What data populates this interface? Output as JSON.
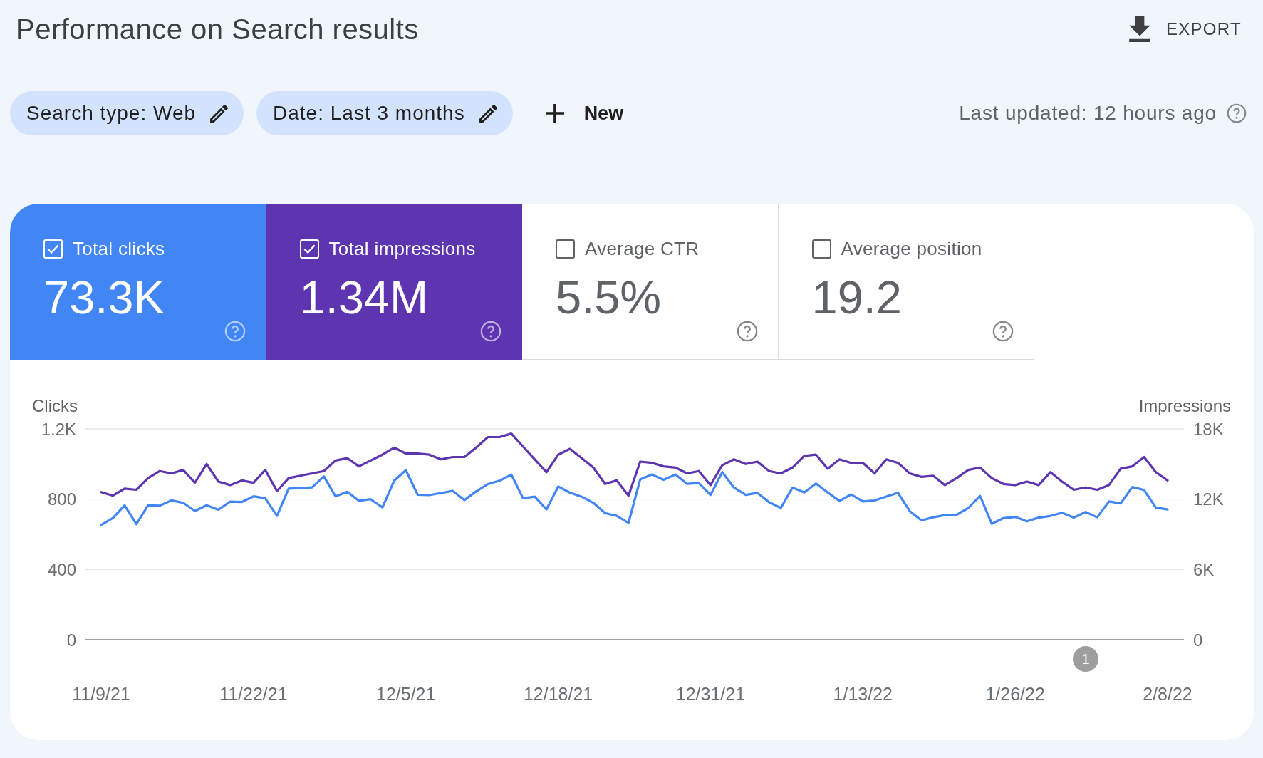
{
  "header": {
    "title": "Performance on Search results",
    "export": {
      "label": "EXPORT"
    }
  },
  "filter_bar": {
    "chips": [
      {
        "label": "Search type: Web"
      },
      {
        "label": "Date: Last 3 months"
      }
    ],
    "new_filter": {
      "label": "New"
    },
    "last_updated": "Last updated: 12 hours ago"
  },
  "metrics": [
    {
      "label": "Total clicks",
      "value": "73.3K",
      "checked": true,
      "color": "#4285f4"
    },
    {
      "label": "Total impressions",
      "value": "1.34M",
      "checked": true,
      "color": "#5e35b1"
    },
    {
      "label": "Average CTR",
      "value": "5.5%",
      "checked": false
    },
    {
      "label": "Average position",
      "value": "19.2",
      "checked": false
    }
  ],
  "chart": {
    "chart_data": {
      "type": "line",
      "ylabel": "Clicks",
      "y2label": "Impressions",
      "categories": [
        "11/9/21",
        null,
        null,
        null,
        null,
        null,
        null,
        null,
        null,
        null,
        null,
        null,
        null,
        "11/22/21",
        null,
        null,
        null,
        null,
        null,
        null,
        null,
        null,
        null,
        null,
        null,
        null,
        "12/5/21",
        null,
        null,
        null,
        null,
        null,
        null,
        null,
        null,
        null,
        null,
        null,
        null,
        "12/18/21",
        null,
        null,
        null,
        null,
        null,
        null,
        null,
        null,
        null,
        null,
        null,
        null,
        "12/31/21",
        null,
        null,
        null,
        null,
        null,
        null,
        null,
        null,
        null,
        null,
        null,
        null,
        "1/13/22",
        null,
        null,
        null,
        null,
        null,
        null,
        null,
        null,
        null,
        null,
        null,
        null,
        "1/26/22",
        null,
        null,
        null,
        null,
        null,
        null,
        null,
        null,
        null,
        null,
        null,
        null,
        "2/8/22"
      ],
      "ylim": [
        0,
        1200
      ],
      "yticks": [
        {
          "value": 0,
          "label": "0"
        },
        {
          "value": 400,
          "label": "400"
        },
        {
          "value": 800,
          "label": "800"
        },
        {
          "value": 1200,
          "label": "1.2K"
        }
      ],
      "y2lim": [
        0,
        18000
      ],
      "y2ticks": [
        {
          "value": 0,
          "label": "0"
        },
        {
          "value": 6000,
          "label": "6K"
        },
        {
          "value": 12000,
          "label": "12K"
        },
        {
          "value": 18000,
          "label": "18K"
        }
      ],
      "series": [
        {
          "color": "#4285f4",
          "values": [
            653,
            693,
            765,
            658,
            765,
            763,
            793,
            779,
            733,
            765,
            740,
            786,
            784,
            816,
            805,
            705,
            860,
            863,
            867,
            930,
            816,
            842,
            791,
            800,
            753,
            905,
            965,
            826,
            823,
            835,
            847,
            795,
            844,
            886,
            905,
            940,
            805,
            814,
            742,
            872,
            837,
            814,
            779,
            721,
            705,
            665,
            912,
            940,
            910,
            940,
            887,
            891,
            824,
            954,
            866,
            824,
            836,
            783,
            750,
            866,
            838,
            889,
            838,
            790,
            827,
            787,
            792,
            815,
            836,
            732,
            679,
            697,
            709,
            711,
            750,
            818,
            660,
            692,
            699,
            674,
            695,
            704,
            723,
            695,
            727,
            697,
            787,
            776,
            869,
            852,
            753,
            741
          ]
        },
        {
          "color": "#5e35b1",
          "axis": "y2",
          "values": [
            12600,
            12300,
            12900,
            12800,
            13800,
            14400,
            14200,
            14500,
            13400,
            15000,
            13500,
            13200,
            13600,
            13400,
            14500,
            12700,
            13800,
            14000,
            14200,
            14400,
            15300,
            15500,
            14800,
            15300,
            15800,
            16400,
            15900,
            15900,
            15800,
            15400,
            15600,
            15600,
            16400,
            17300,
            17300,
            17600,
            16500,
            15400,
            14300,
            15800,
            16300,
            15500,
            14700,
            13300,
            13600,
            12300,
            15200,
            15100,
            14800,
            14700,
            14200,
            14400,
            13200,
            14900,
            15400,
            15000,
            15200,
            14400,
            14200,
            14700,
            15700,
            15800,
            14600,
            15400,
            15100,
            15100,
            14200,
            15400,
            15100,
            14200,
            13900,
            14000,
            13200,
            13800,
            14500,
            14700,
            13800,
            13300,
            13200,
            13500,
            13200,
            14300,
            13500,
            12800,
            13000,
            12800,
            13200,
            14600,
            14800,
            15600,
            14300,
            13600
          ]
        }
      ],
      "annotations": [
        "1"
      ]
    }
  }
}
